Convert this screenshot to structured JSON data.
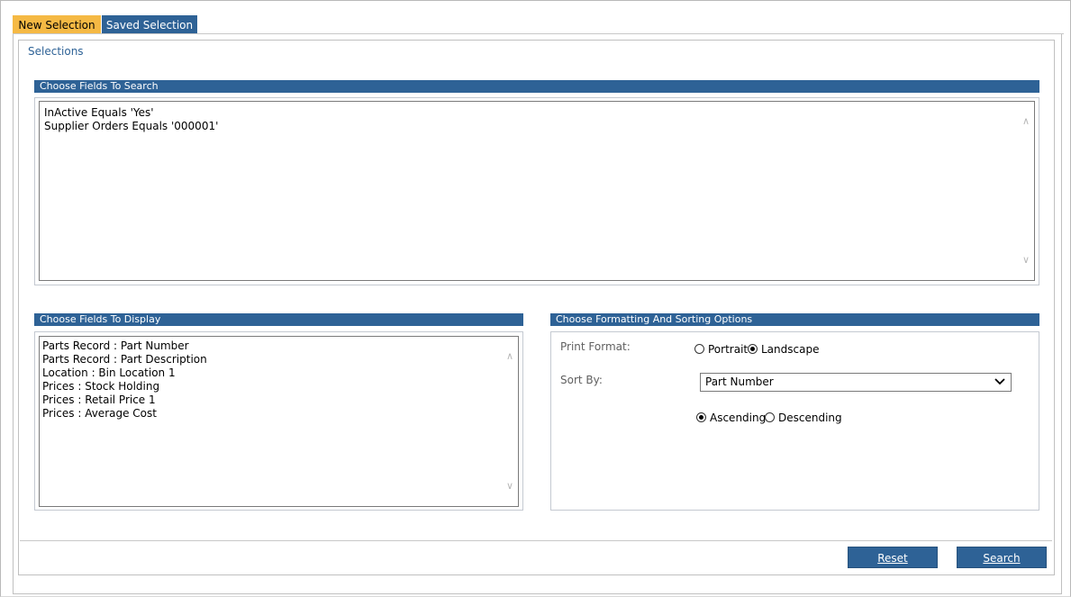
{
  "tabs": [
    {
      "label": "New Selection",
      "active": true
    },
    {
      "label": "Saved Selection",
      "active": false
    }
  ],
  "selections_title": "Selections",
  "search_fields": {
    "header": "Choose Fields To Search",
    "lines": [
      "InActive Equals 'Yes'",
      "Supplier Orders Equals '000001'"
    ]
  },
  "display_fields": {
    "header": "Choose Fields To Display",
    "lines": [
      "Parts Record : Part Number",
      "Parts Record : Part Description",
      "Location : Bin Location 1",
      "Prices : Stock Holding",
      "Prices : Retail Price 1",
      "Prices : Average Cost"
    ]
  },
  "formatting": {
    "header": "Choose Formatting And Sorting Options",
    "print_format_label": "Print Format:",
    "portrait_label": "Portrait",
    "landscape_label": "Landscape",
    "print_format_selected": "Landscape",
    "sort_by_label": "Sort By:",
    "sort_by_value": "Part Number",
    "ascending_label": "Ascending",
    "descending_label": "Descending",
    "sort_order_selected": "Ascending"
  },
  "buttons": {
    "reset": "Reset",
    "search": "Search"
  },
  "colors": {
    "accent_blue": "#2e6296",
    "active_tab": "#f5b944"
  }
}
